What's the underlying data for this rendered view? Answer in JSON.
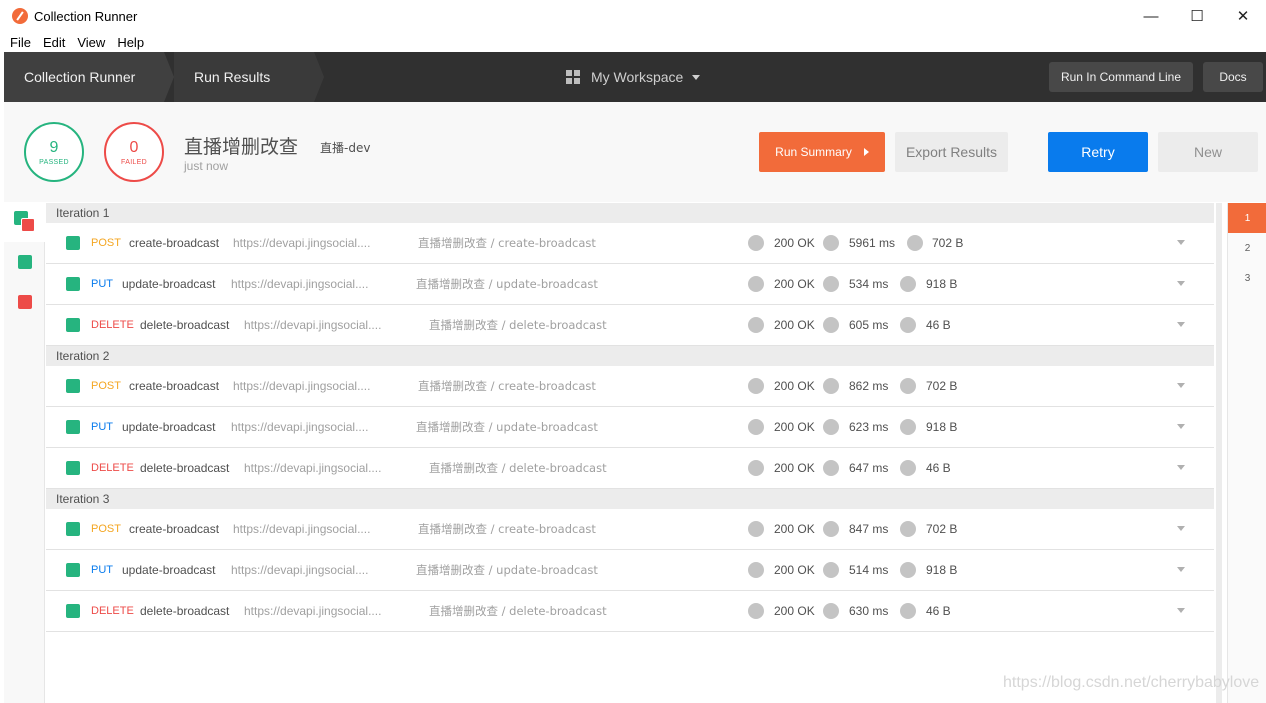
{
  "window": {
    "title": "Collection Runner",
    "controls": [
      "—",
      "☐",
      "✕"
    ]
  },
  "menu": [
    "File",
    "Edit",
    "View",
    "Help"
  ],
  "header": {
    "breadcrumb": [
      "Collection Runner",
      "Run Results"
    ],
    "workspace": "My Workspace",
    "run_cli": "Run In Command Line",
    "docs": "Docs"
  },
  "summary": {
    "passed_count": "9",
    "passed_label": "PASSED",
    "failed_count": "0",
    "failed_label": "FAILED",
    "collection_name": "直播增删改查",
    "environment": "直播-dev",
    "time": "just now",
    "run_summary": "Run Summary",
    "export": "Export Results",
    "retry": "Retry",
    "new": "New"
  },
  "iterations": [
    {
      "label": "Iteration 1",
      "requests": [
        {
          "method": "POST",
          "name": "create-broadcast",
          "url": "https://devapi.jingsocial....",
          "path": "直播增删改查 / create-broadcast",
          "status": "200 OK",
          "time": "5961 ms",
          "size": "702 B"
        },
        {
          "method": "PUT",
          "name": "update-broadcast",
          "url": "https://devapi.jingsocial....",
          "path": "直播增删改查 / update-broadcast",
          "status": "200 OK",
          "time": "534 ms",
          "size": "918 B"
        },
        {
          "method": "DELETE",
          "name": "delete-broadcast",
          "url": "https://devapi.jingsocial....",
          "path": "直播增删改查 / delete-broadcast",
          "status": "200 OK",
          "time": "605 ms",
          "size": "46 B"
        }
      ]
    },
    {
      "label": "Iteration 2",
      "requests": [
        {
          "method": "POST",
          "name": "create-broadcast",
          "url": "https://devapi.jingsocial....",
          "path": "直播增删改查 / create-broadcast",
          "status": "200 OK",
          "time": "862 ms",
          "size": "702 B"
        },
        {
          "method": "PUT",
          "name": "update-broadcast",
          "url": "https://devapi.jingsocial....",
          "path": "直播增删改查 / update-broadcast",
          "status": "200 OK",
          "time": "623 ms",
          "size": "918 B"
        },
        {
          "method": "DELETE",
          "name": "delete-broadcast",
          "url": "https://devapi.jingsocial....",
          "path": "直播增删改查 / delete-broadcast",
          "status": "200 OK",
          "time": "647 ms",
          "size": "46 B"
        }
      ]
    },
    {
      "label": "Iteration 3",
      "requests": [
        {
          "method": "POST",
          "name": "create-broadcast",
          "url": "https://devapi.jingsocial....",
          "path": "直播增删改查 / create-broadcast",
          "status": "200 OK",
          "time": "847 ms",
          "size": "702 B"
        },
        {
          "method": "PUT",
          "name": "update-broadcast",
          "url": "https://devapi.jingsocial....",
          "path": "直播增删改查 / update-broadcast",
          "status": "200 OK",
          "time": "514 ms",
          "size": "918 B"
        },
        {
          "method": "DELETE",
          "name": "delete-broadcast",
          "url": "https://devapi.jingsocial....",
          "path": "直播增删改查 / delete-broadcast",
          "status": "200 OK",
          "time": "630 ms",
          "size": "46 B"
        }
      ]
    }
  ],
  "iteration_nav": [
    "1",
    "2",
    "3"
  ],
  "watermark": "https://blog.csdn.net/cherrybabylove",
  "colors": {
    "accent": "#f26b3a",
    "pass": "#26b47f",
    "fail": "#ed4b48",
    "primary": "#097bed",
    "post": "#f4a622",
    "put": "#097bed",
    "delete": "#ed4b48"
  }
}
